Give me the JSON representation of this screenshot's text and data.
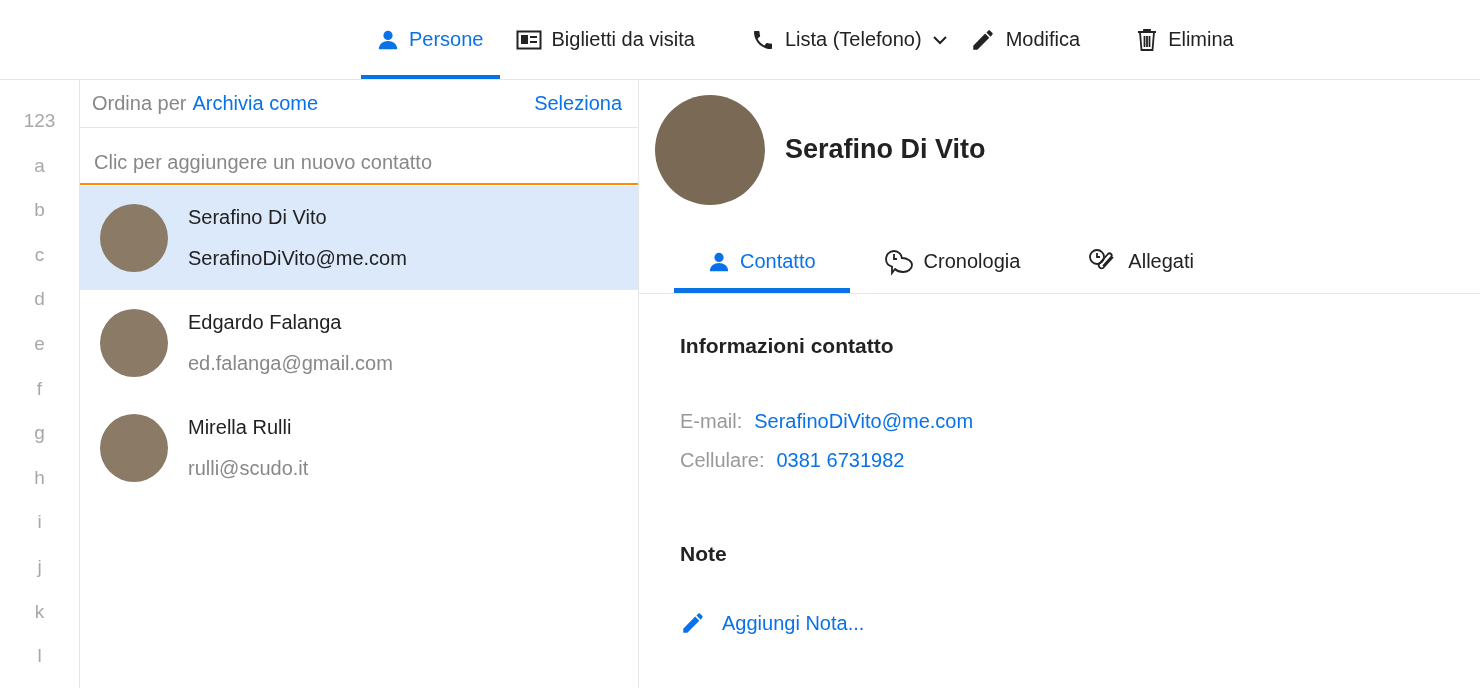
{
  "toolbar": [
    {
      "kind": "view",
      "label": "Persone",
      "selected": true
    },
    {
      "kind": "view",
      "label": "Biglietti da visita",
      "selected": false
    },
    {
      "kind": "dropdown",
      "label": "Lista (Telefono)",
      "selected": false
    },
    {
      "kind": "edit",
      "label": "Modifica"
    },
    {
      "kind": "delete",
      "label": "Elimina"
    }
  ],
  "index": [
    "123",
    "a",
    "b",
    "c",
    "d",
    "e",
    "f",
    "g",
    "h",
    "i",
    "j",
    "k",
    "l"
  ],
  "list_header": {
    "sort_label": "Ordina per",
    "sort_value": "Archivia come",
    "select": "Seleziona"
  },
  "new_contact": {
    "placeholder": "Clic per aggiungere un nuovo contatto"
  },
  "contacts": [
    {
      "name": "Serafino Di Vito",
      "email": "SerafinoDiVito@me.com",
      "selected": true
    },
    {
      "name": "Edgardo Falanga",
      "email": "ed.falanga@gmail.com",
      "selected": false
    },
    {
      "name": "Mirella Rulli",
      "email": "rulli@scudo.it",
      "selected": false
    }
  ],
  "detail": {
    "name": "Serafino Di Vito",
    "tabs": [
      {
        "kind": "contact",
        "label": "Contatto",
        "selected": true
      },
      {
        "kind": "history",
        "label": "Cronologia",
        "selected": false
      },
      {
        "kind": "attachments",
        "label": "Allegati",
        "selected": false
      }
    ],
    "info_title": "Informazioni contatto",
    "fields": [
      {
        "label": "E-mail:",
        "value": "SerafinoDiVito@me.com"
      },
      {
        "label": "Cellulare:",
        "value": "0381 6731982"
      }
    ],
    "notes_title": "Note",
    "add_note": "Aggiungi Nota..."
  }
}
